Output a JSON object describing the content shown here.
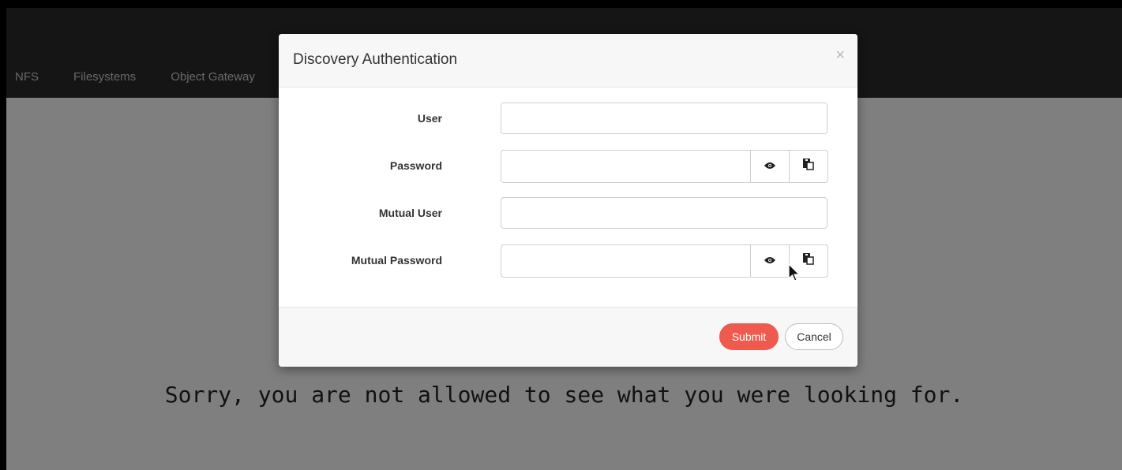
{
  "nav": {
    "items": [
      "NFS",
      "Filesystems",
      "Object Gateway"
    ]
  },
  "page": {
    "error_message": "Sorry, you are not allowed to see what you were looking for."
  },
  "modal": {
    "title": "Discovery Authentication",
    "close_symbol": "×",
    "fields": {
      "user_label": "User",
      "password_label": "Password",
      "mutual_user_label": "Mutual User",
      "mutual_password_label": "Mutual Password"
    },
    "icons": {
      "show_password": "eye-icon",
      "copy": "clipboard-icon"
    },
    "buttons": {
      "submit": "Submit",
      "cancel": "Cancel"
    }
  },
  "colors": {
    "navbar": "#2b2b2b",
    "submit": "#ef5a4f",
    "overlay": "rgba(0,0,0,0.5)"
  }
}
